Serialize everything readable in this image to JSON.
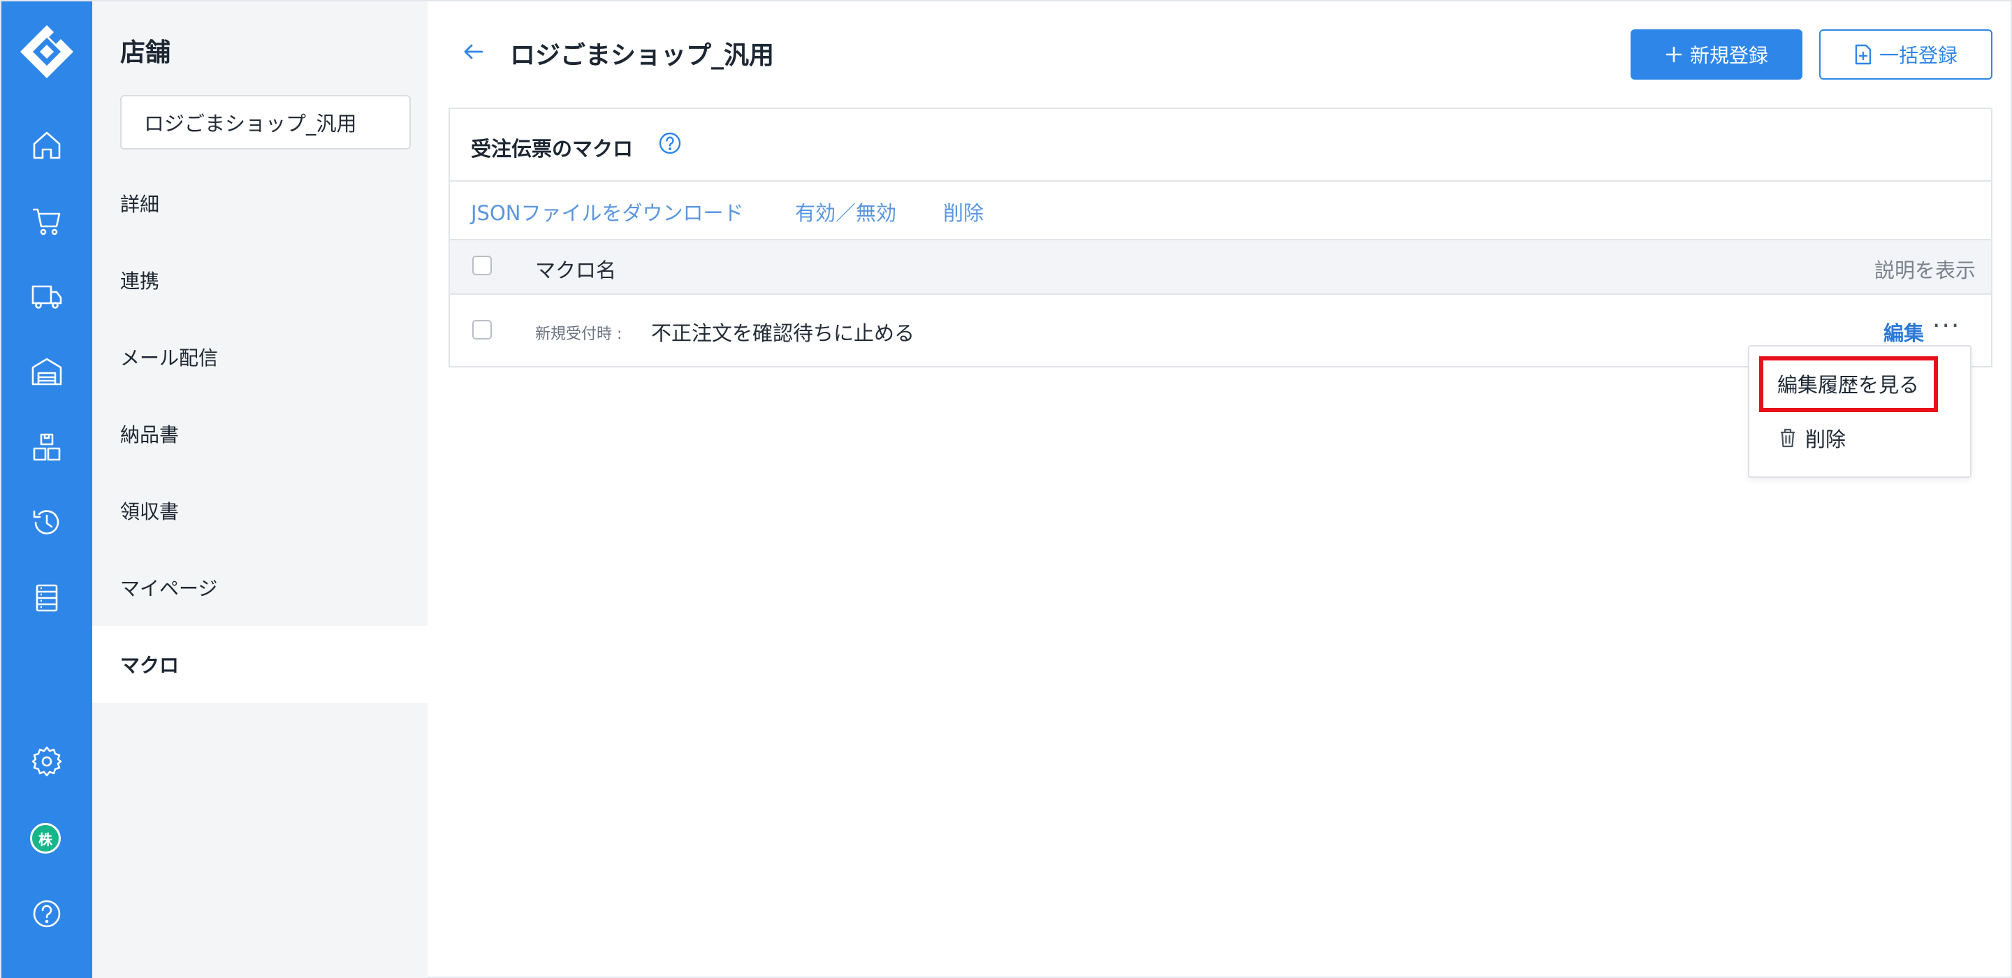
{
  "rail": {
    "items": [
      {
        "name": "home-icon"
      },
      {
        "name": "cart-icon"
      },
      {
        "name": "truck-icon"
      },
      {
        "name": "warehouse-icon"
      },
      {
        "name": "boxes-icon"
      },
      {
        "name": "history-icon"
      },
      {
        "name": "list-icon"
      },
      {
        "name": "gear-icon"
      },
      {
        "name": "company-badge-icon"
      },
      {
        "name": "help-icon"
      }
    ],
    "badge_label": "株"
  },
  "sidebar": {
    "title": "店舗",
    "shop_select_value": "ロジごまショップ_汎用",
    "items": [
      {
        "label": "詳細"
      },
      {
        "label": "連携"
      },
      {
        "label": "メール配信"
      },
      {
        "label": "納品書"
      },
      {
        "label": "領収書"
      },
      {
        "label": "マイページ"
      },
      {
        "label": "マクロ",
        "active": true
      }
    ]
  },
  "header": {
    "title": "ロジごまショップ_汎用",
    "new_button": "新規登録",
    "bulk_button": "一括登録"
  },
  "card": {
    "title": "受注伝票のマクロ",
    "actions": [
      "JSONファイルをダウンロード",
      "有効／無効",
      "削除"
    ],
    "columns": {
      "name": "マクロ名",
      "description": "説明を表示"
    },
    "rows": [
      {
        "prefix": "新規受付時 :",
        "name": "不正注文を確認待ちに止める",
        "edit": "編集",
        "more": "···"
      }
    ]
  },
  "dropdown": {
    "items": [
      {
        "label": "編集履歴を見る"
      },
      {
        "label": "削除",
        "icon": "trash-icon"
      }
    ]
  },
  "colors": {
    "accent": "#2e86e8",
    "highlight": "#e8101a",
    "badge": "#16b58a"
  }
}
